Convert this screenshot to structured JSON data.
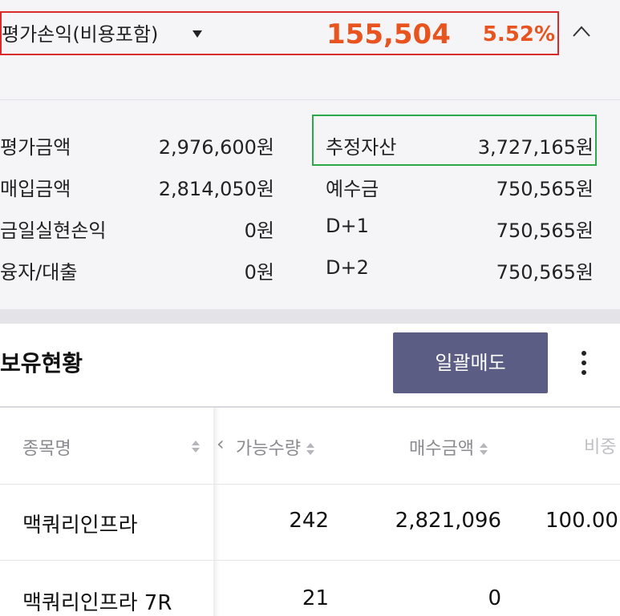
{
  "summary": {
    "pnl_label": "평가손익(비용포함)",
    "pnl_amount": "155,504",
    "pnl_rate": "5.52%",
    "colors": {
      "profit": "#e8541f",
      "highlight_red": "#d92b2b",
      "highlight_green": "#2aa84a"
    }
  },
  "details": {
    "left": [
      {
        "label": "평가금액",
        "value": "2,976,600원"
      },
      {
        "label": "매입금액",
        "value": "2,814,050원"
      },
      {
        "label": "금일실현손익",
        "value": "0원"
      },
      {
        "label": "융자/대출",
        "value": "0원"
      }
    ],
    "right": [
      {
        "label": "추정자산",
        "value": "3,727,165원"
      },
      {
        "label": "예수금",
        "value": "750,565원"
      },
      {
        "label": "D+1",
        "value": "750,565원"
      },
      {
        "label": "D+2",
        "value": "750,565원"
      }
    ]
  },
  "holdings": {
    "title": "보유현황",
    "sell_all_label": "일괄매도",
    "columns": [
      "종목명",
      "가능수량",
      "매수금액",
      "비중"
    ],
    "cut_column_visible": "비중",
    "rows": [
      {
        "name": "맥쿼리인프라",
        "qty": "242",
        "buy_amount": "2,821,096",
        "weight": "100.00"
      },
      {
        "name": "맥쿼리인프라 7R",
        "qty": "21",
        "buy_amount": "0",
        "weight": ""
      }
    ]
  }
}
